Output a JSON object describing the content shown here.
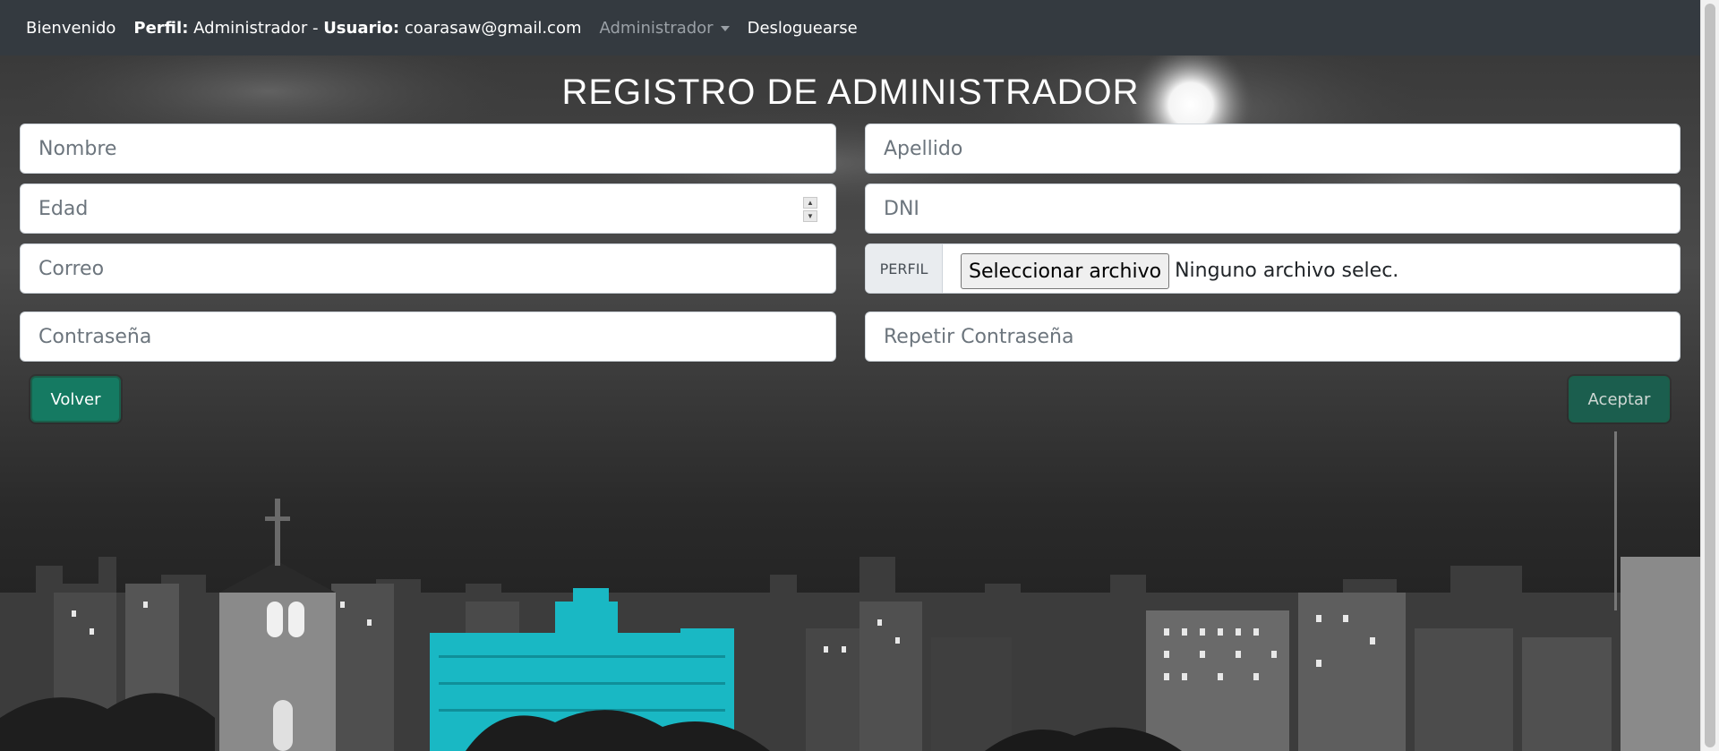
{
  "navbar": {
    "welcome": "Bienvenido",
    "profile_label": "Perfil:",
    "profile_value": "Administrador",
    "separator": "-",
    "user_label": "Usuario:",
    "user_value": "coarasaw@gmail.com",
    "admin_menu": "Administrador",
    "logout": "Desloguearse"
  },
  "page": {
    "title": "REGISTRO DE ADMINISTRADOR"
  },
  "form": {
    "nombre_placeholder": "Nombre",
    "apellido_placeholder": "Apellido",
    "edad_placeholder": "Edad",
    "dni_placeholder": "DNI",
    "correo_placeholder": "Correo",
    "perfil_label": "PERFIL",
    "file_button": "Seleccionar archivo",
    "file_status": "Ninguno archivo selec.",
    "password_placeholder": "Contraseña",
    "repeat_password_placeholder": "Repetir Contraseña",
    "back_button": "Volver",
    "accept_button": "Aceptar"
  },
  "colors": {
    "navbar": "#343a40",
    "button_primary": "#157a62",
    "building_highlight": "#19b8c4"
  }
}
